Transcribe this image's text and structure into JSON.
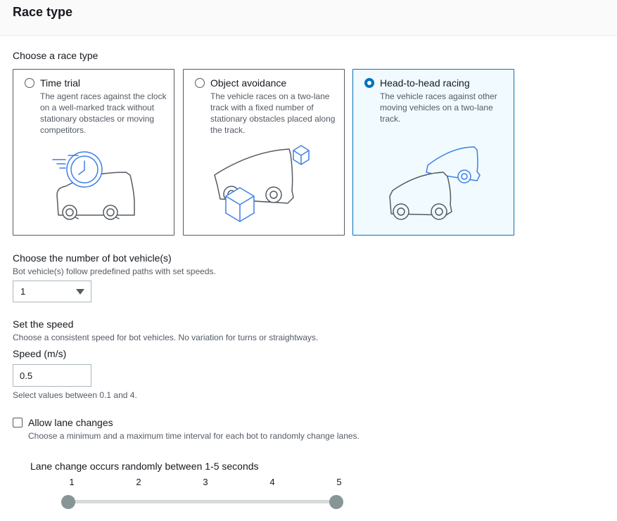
{
  "header": {
    "title": "Race type"
  },
  "race_type": {
    "label": "Choose a race type",
    "options": [
      {
        "title": "Time trial",
        "description": "The agent races against the clock on a well-marked track without stationary obstacles or moving competitors.",
        "selected": false,
        "icon": "car-with-clock-icon"
      },
      {
        "title": "Object avoidance",
        "description": "The vehicle races on a two-lane track with a fixed number of stationary obstacles placed along the track.",
        "selected": false,
        "icon": "car-with-boxes-icon"
      },
      {
        "title": "Head-to-head racing",
        "description": "The vehicle races against other moving vehicles on a two-lane track.",
        "selected": true,
        "icon": "two-cars-icon"
      }
    ]
  },
  "bots": {
    "label": "Choose the number of bot vehicle(s)",
    "description": "Bot vehicle(s) follow predefined paths with set speeds.",
    "selected": "1"
  },
  "speed": {
    "label": "Set the speed",
    "description": "Choose a consistent speed for bot vehicles. No variation for turns or straightways.",
    "field_label": "Speed (m/s)",
    "value": "0.5",
    "hint": "Select values between 0.1 and 4."
  },
  "lane": {
    "checkbox_label": "Allow lane changes",
    "checked": false,
    "description": "Choose a minimum and a maximum time interval for each bot to randomly change lanes.",
    "slider_label": "Lane change occurs randomly between 1-5 seconds",
    "ticks": [
      "1",
      "2",
      "3",
      "4",
      "5"
    ],
    "range_min": 1,
    "range_max": 5
  },
  "colors": {
    "accent": "#0073bb",
    "illustration_blue": "#3f7fe8",
    "illustration_gray": "#545b64"
  }
}
